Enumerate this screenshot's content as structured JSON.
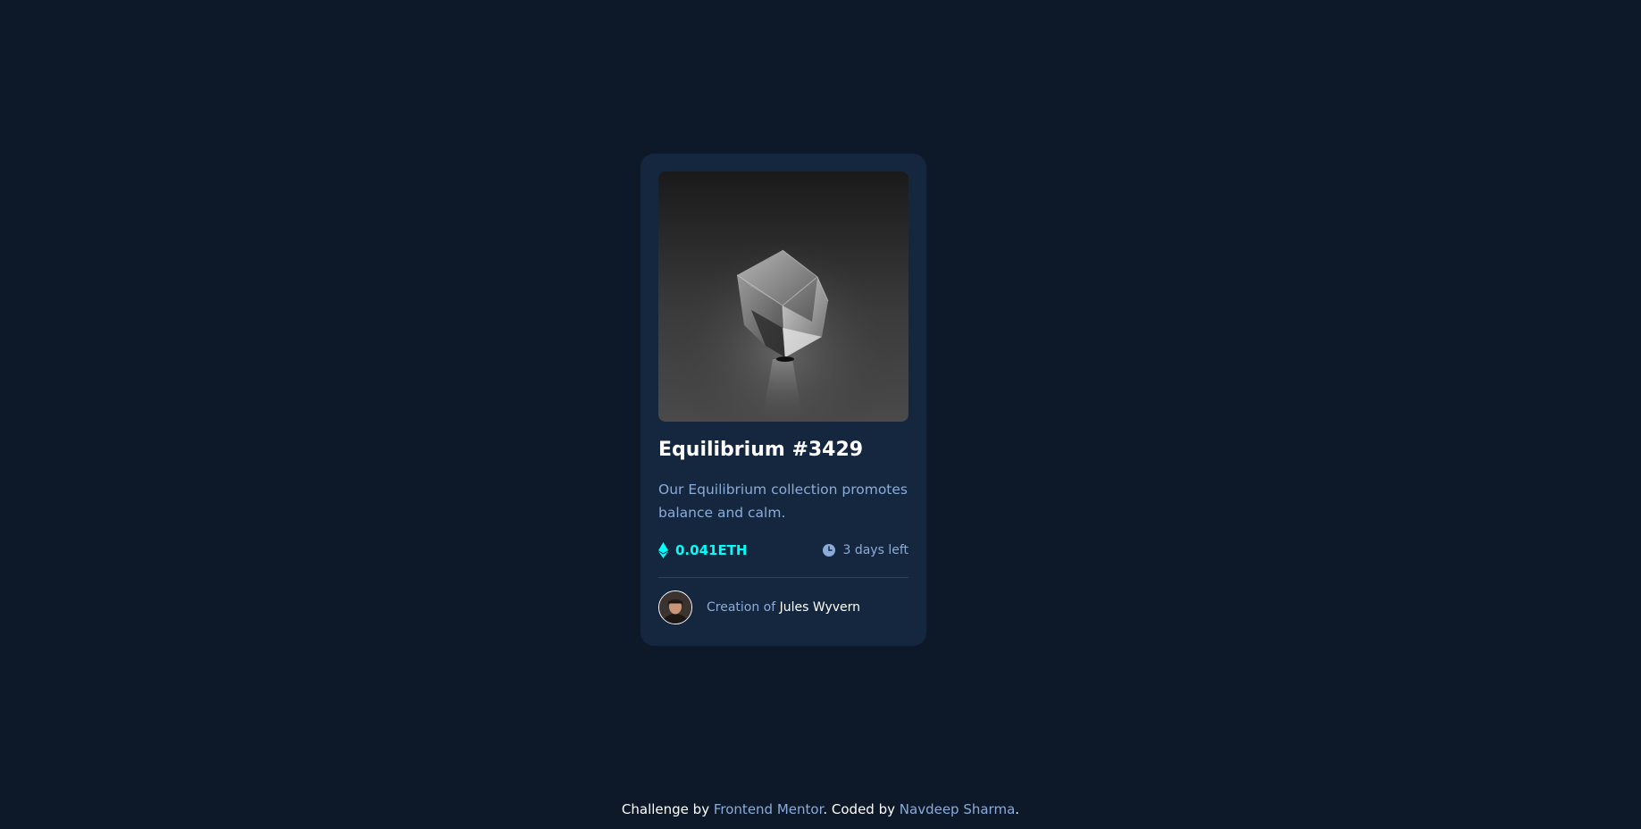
{
  "card": {
    "title": "Equilibrium #3429",
    "description": "Our Equilibrium collection promotes balance and calm.",
    "price": "0.041ETH",
    "time_left": "3 days left",
    "creator_prefix": "Creation of",
    "creator_name": "Jules Wyvern"
  },
  "footer": {
    "text_1": "Challenge by",
    "link_1": "Frontend Mentor",
    "text_2": ". Coded by",
    "link_2": "Navdeep Sharma",
    "text_3": "."
  },
  "colors": {
    "page_bg": "#0d1829",
    "card_bg": "#15263f",
    "accent_cyan": "#00fff8",
    "soft_blue": "#8bacd9",
    "white": "#ffffff"
  },
  "icons": {
    "price": "ethereum-icon",
    "time": "clock-icon"
  }
}
